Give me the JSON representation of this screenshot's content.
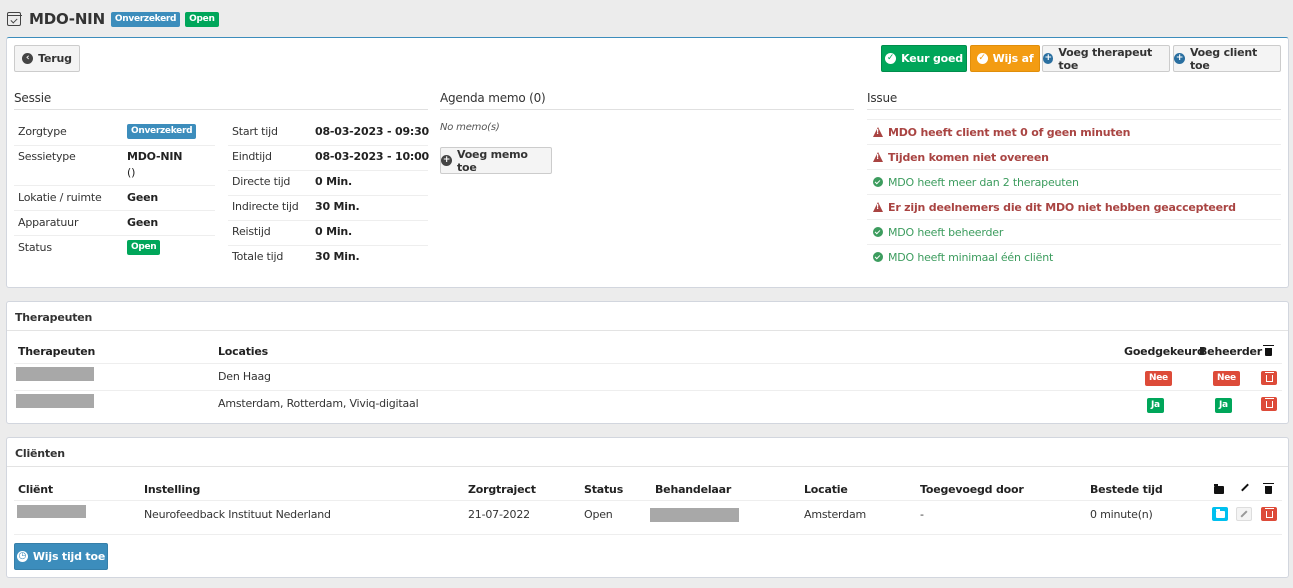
{
  "header": {
    "title": "MDO-NIN",
    "badge_type": "Onverzekerd",
    "badge_status": "Open"
  },
  "toolbar": {
    "back": "Terug",
    "approve": "Keur goed",
    "reject": "Wijs af",
    "add_therapist": "Voeg therapeut toe",
    "add_client": "Voeg client toe"
  },
  "sessie": {
    "heading": "Sessie",
    "left": [
      {
        "label": "Zorgtype",
        "badge": "Onverzekerd"
      },
      {
        "label": "Sessietype",
        "value": "MDO-NIN",
        "value2": "()"
      },
      {
        "label": "Lokatie / ruimte",
        "value": "Geen"
      },
      {
        "label": "Apparatuur",
        "value": "Geen"
      },
      {
        "label": "Status",
        "badge": "Open"
      }
    ],
    "right": [
      {
        "label": "Start tijd",
        "value": "08-03-2023 - 09:30"
      },
      {
        "label": "Eindtijd",
        "value": "08-03-2023 - 10:00"
      },
      {
        "label": "Directe tijd",
        "value": "0 Min."
      },
      {
        "label": "Indirecte tijd",
        "value": "30 Min."
      },
      {
        "label": "Reistijd",
        "value": "0 Min."
      },
      {
        "label": "Totale tijd",
        "value": "30 Min."
      }
    ]
  },
  "memo": {
    "heading": "Agenda memo (0)",
    "empty": "No memo(s)",
    "add": "Voeg memo toe"
  },
  "issue": {
    "heading": "Issue",
    "items": [
      {
        "type": "error",
        "text": "MDO heeft client met 0 of geen minuten"
      },
      {
        "type": "error",
        "text": "Tijden komen niet overeen"
      },
      {
        "type": "ok",
        "text": "MDO heeft meer dan 2 therapeuten"
      },
      {
        "type": "error",
        "text": "Er zijn deelnemers die dit MDO niet hebben geaccepteerd"
      },
      {
        "type": "ok",
        "text": "MDO heeft beheerder"
      },
      {
        "type": "ok",
        "text": "MDO heeft minimaal één cliënt"
      }
    ]
  },
  "therapeuten": {
    "title": "Therapeuten",
    "columns": {
      "name": "Therapeuten",
      "locations": "Locaties",
      "approved": "Goedgekeurd",
      "admin": "Beheerder"
    },
    "rows": [
      {
        "locations": "Den Haag",
        "approved": "Nee",
        "admin": "Nee"
      },
      {
        "locations": "Amsterdam, Rotterdam, Viviq-digitaal",
        "approved": "Ja",
        "admin": "Ja"
      }
    ]
  },
  "clienten": {
    "title": "Cliënten",
    "columns": {
      "client": "Cliënt",
      "instelling": "Instelling",
      "zorgtraject": "Zorgtraject",
      "status": "Status",
      "behandelaar": "Behandelaar",
      "locatie": "Locatie",
      "toegevoegd": "Toegevoegd door",
      "bestede": "Bestede tijd"
    },
    "rows": [
      {
        "instelling": "Neurofeedback Instituut Nederland",
        "zorgtraject": "21-07-2022",
        "status": "Open",
        "locatie": "Amsterdam",
        "toegevoegd": "-",
        "bestede": "0 minute(n)"
      }
    ],
    "add_time": "Wijs tijd toe"
  }
}
